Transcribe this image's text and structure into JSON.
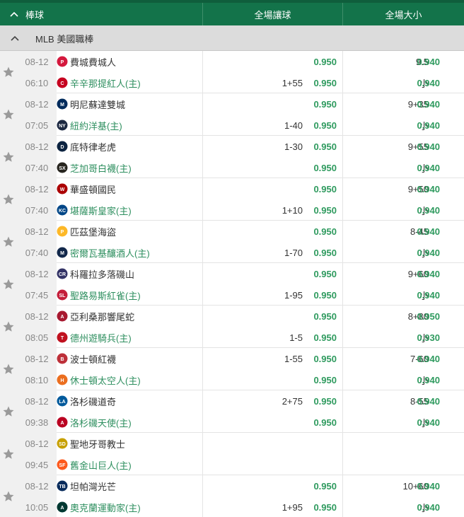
{
  "header": {
    "sport": "棒球",
    "handicap_col": "全場讓球",
    "overunder_col": "全場大小"
  },
  "league": {
    "name": "MLB 美國職棒"
  },
  "colors": {
    "header_bg": "#13734a",
    "odds_green": "#2e9a5e",
    "home_team": "#2e8f5f"
  },
  "matches": [
    {
      "date": "08-12",
      "time": "06:10",
      "away": {
        "name": "費城費城人",
        "logo_color": "#d4183d",
        "logo": "P"
      },
      "home": {
        "name": "辛辛那提紅人(主)",
        "logo_color": "#c6011f",
        "logo": "C"
      },
      "hc_away": {
        "line": "",
        "odds": "0.950"
      },
      "hc_home": {
        "line": "1+55",
        "odds": "0.950"
      },
      "ou_over": {
        "line": "9.5",
        "odds": "0.940"
      },
      "ou_under": {
        "line": "小",
        "odds": "0.940"
      }
    },
    {
      "date": "08-12",
      "time": "07:05",
      "away": {
        "name": "明尼蘇達雙城",
        "logo_color": "#002b5c",
        "logo": "M"
      },
      "home": {
        "name": "紐約洋基(主)",
        "logo_color": "#1c2841",
        "logo": "NY"
      },
      "hc_away": {
        "line": "",
        "odds": "0.950"
      },
      "hc_home": {
        "line": "1-40",
        "odds": "0.950"
      },
      "ou_over": {
        "line": "9+35",
        "odds": "0.940"
      },
      "ou_under": {
        "line": "小",
        "odds": "0.940"
      }
    },
    {
      "date": "08-12",
      "time": "07:40",
      "away": {
        "name": "底特律老虎",
        "logo_color": "#0c2340",
        "logo": "D"
      },
      "home": {
        "name": "芝加哥白襪(主)",
        "logo_color": "#27251f",
        "logo": "SX"
      },
      "hc_away": {
        "line": "1-30",
        "odds": "0.950"
      },
      "hc_home": {
        "line": "",
        "odds": "0.950"
      },
      "ou_over": {
        "line": "9+55",
        "odds": "0.940"
      },
      "ou_under": {
        "line": "小",
        "odds": "0.940"
      }
    },
    {
      "date": "08-12",
      "time": "07:40",
      "away": {
        "name": "華盛頓國民",
        "logo_color": "#ab0003",
        "logo": "W"
      },
      "home": {
        "name": "堪薩斯皇家(主)",
        "logo_color": "#004687",
        "logo": "KC"
      },
      "hc_away": {
        "line": "",
        "odds": "0.950"
      },
      "hc_home": {
        "line": "1+10",
        "odds": "0.950"
      },
      "ou_over": {
        "line": "9+50",
        "odds": "0.940"
      },
      "ou_under": {
        "line": "小",
        "odds": "0.940"
      }
    },
    {
      "date": "08-12",
      "time": "07:40",
      "away": {
        "name": "匹茲堡海盜",
        "logo_color": "#fdb827",
        "logo": "P"
      },
      "home": {
        "name": "密爾瓦基釀酒人(主)",
        "logo_color": "#12284b",
        "logo": "M"
      },
      "hc_away": {
        "line": "",
        "odds": "0.950"
      },
      "hc_home": {
        "line": "1-70",
        "odds": "0.950"
      },
      "ou_over": {
        "line": "8-45",
        "odds": "0.940"
      },
      "ou_under": {
        "line": "小",
        "odds": "0.940"
      }
    },
    {
      "date": "08-12",
      "time": "07:45",
      "away": {
        "name": "科羅拉多落磯山",
        "logo_color": "#333366",
        "logo": "CR"
      },
      "home": {
        "name": "聖路易斯紅雀(主)",
        "logo_color": "#c41e3a",
        "logo": "SL"
      },
      "hc_away": {
        "line": "",
        "odds": "0.950"
      },
      "hc_home": {
        "line": "1-95",
        "odds": "0.950"
      },
      "ou_over": {
        "line": "9+60",
        "odds": "0.940"
      },
      "ou_under": {
        "line": "小",
        "odds": "0.940"
      }
    },
    {
      "date": "08-12",
      "time": "08:05",
      "away": {
        "name": "亞利桑那響尾蛇",
        "logo_color": "#a71930",
        "logo": "A"
      },
      "home": {
        "name": "德州遊騎兵(主)",
        "logo_color": "#c0111f",
        "logo": "T"
      },
      "hc_away": {
        "line": "",
        "odds": "0.950"
      },
      "hc_home": {
        "line": "1-5",
        "odds": "0.950"
      },
      "ou_over": {
        "line": "8+80",
        "odds": "0.950"
      },
      "ou_under": {
        "line": "小",
        "odds": "0.930"
      }
    },
    {
      "date": "08-12",
      "time": "08:10",
      "away": {
        "name": "波士頓紅襪",
        "logo_color": "#bd3039",
        "logo": "B"
      },
      "home": {
        "name": "休士頓太空人(主)",
        "logo_color": "#eb6e1f",
        "logo": "H"
      },
      "hc_away": {
        "line": "1-55",
        "odds": "0.950"
      },
      "hc_home": {
        "line": "",
        "odds": "0.950"
      },
      "ou_over": {
        "line": "7-60",
        "odds": "0.940"
      },
      "ou_under": {
        "line": "小",
        "odds": "0.940"
      }
    },
    {
      "date": "08-12",
      "time": "09:38",
      "away": {
        "name": "洛杉磯道奇",
        "logo_color": "#005a9c",
        "logo": "LA"
      },
      "home": {
        "name": "洛杉磯天使(主)",
        "logo_color": "#ba0021",
        "logo": "A"
      },
      "hc_away": {
        "line": "2+75",
        "odds": "0.950"
      },
      "hc_home": {
        "line": "",
        "odds": "0.950"
      },
      "ou_over": {
        "line": "8-55",
        "odds": "0.940"
      },
      "ou_under": {
        "line": "小",
        "odds": "0.940"
      }
    },
    {
      "date": "08-12",
      "time": "09:45",
      "away": {
        "name": "聖地牙哥教士",
        "logo_color": "#c7a000",
        "logo": "SD"
      },
      "home": {
        "name": "舊金山巨人(主)",
        "logo_color": "#fd5a1e",
        "logo": "SF"
      },
      "hc_away": {
        "line": "",
        "odds": ""
      },
      "hc_home": {
        "line": "",
        "odds": ""
      },
      "ou_over": {
        "line": "",
        "odds": ""
      },
      "ou_under": {
        "line": "",
        "odds": ""
      }
    },
    {
      "date": "08-12",
      "time": "10:05",
      "away": {
        "name": "坦帕灣光芒",
        "logo_color": "#092c5c",
        "logo": "TB"
      },
      "home": {
        "name": "奧克蘭運動家(主)",
        "logo_color": "#003831",
        "logo": "A"
      },
      "hc_away": {
        "line": "",
        "odds": "0.950"
      },
      "hc_home": {
        "line": "1+95",
        "odds": "0.950"
      },
      "ou_over": {
        "line": "10+60",
        "odds": "0.940"
      },
      "ou_under": {
        "line": "小",
        "odds": "0.940"
      }
    }
  ]
}
